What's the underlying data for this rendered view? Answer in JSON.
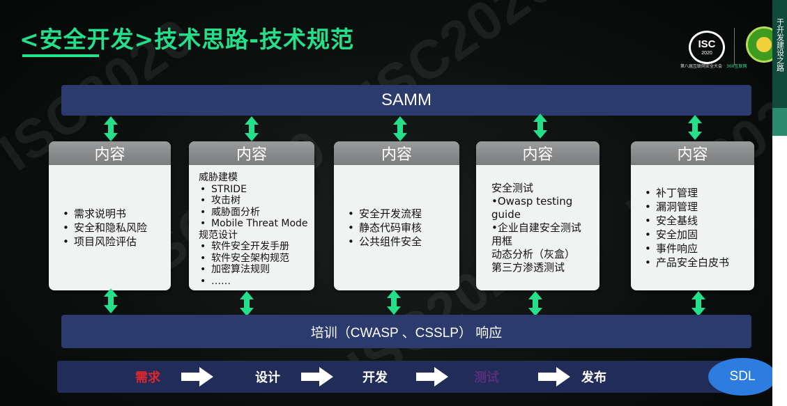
{
  "slide": {
    "title": "<安全开发>技术思路-技术规范",
    "watermark": "ISC2020",
    "logo": {
      "isc": "ISC",
      "isc_year": "2020",
      "caption_left": "第八届互联网安全大会",
      "caption_right": "360互联网"
    },
    "top_bar": "SAMM",
    "bottom_bar": "培训（CWASP 、CSSLP） 响应",
    "cards": [
      {
        "header": "内容",
        "items": [
          "需求说明书",
          "安全和隐私风险",
          "项目风险评估"
        ]
      },
      {
        "header": "内容",
        "group1_title": "威胁建模",
        "group1_items": [
          "STRIDE",
          "攻击树",
          "威胁面分析",
          "Mobile Threat Mode"
        ],
        "group2_title": "规范设计",
        "group2_items": [
          "软件安全开发手册",
          "软件安全架构规范",
          "加密算法规则",
          "……"
        ]
      },
      {
        "header": "内容",
        "items": [
          "安全开发流程",
          "静态代码审核",
          "公共组件安全"
        ]
      },
      {
        "header": "内容",
        "lines": [
          "安全测试",
          "•Owasp testing",
          "guide",
          "•企业自建安全测试",
          "用框",
          "动态分析（灰盒）",
          "第三方渗透测试"
        ]
      },
      {
        "header": "内容",
        "items": [
          "补丁管理",
          "漏洞管理",
          "安全基线",
          "安全加固",
          "事件响应",
          "产品安全白皮书"
        ]
      }
    ],
    "process": {
      "steps": [
        "需求",
        "设计",
        "开发",
        "测试",
        "发布"
      ],
      "end_label": "SDL"
    },
    "side_strip_text": "于开发建设之路",
    "colors": {
      "accent_green": "#24e08a",
      "bar_blue": "#2c3b6e",
      "requirement_red": "#e0262c",
      "sdl_blue": "#2d7de0"
    }
  }
}
